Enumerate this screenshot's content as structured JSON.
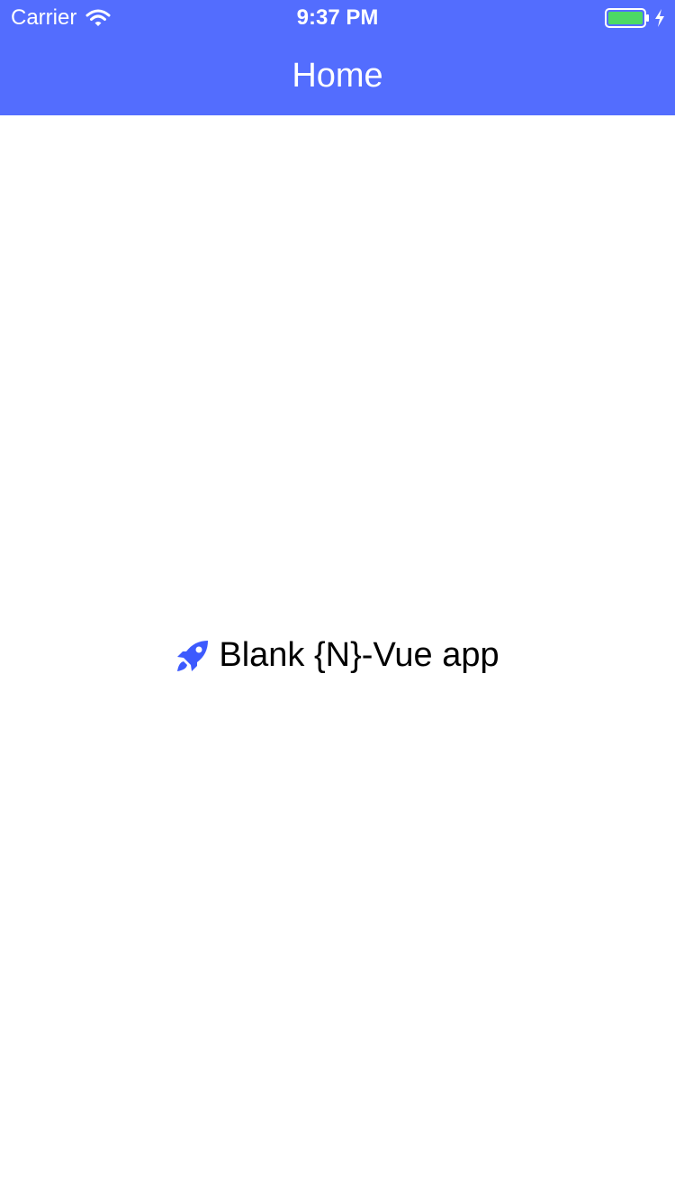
{
  "status_bar": {
    "carrier": "Carrier",
    "time": "9:37 PM",
    "icons": [
      "wifi-icon",
      "battery-icon",
      "charging-icon"
    ],
    "battery_color": "#4CD964"
  },
  "nav": {
    "title": "Home",
    "background_color": "#536DFE"
  },
  "content": {
    "icon": "rocket-icon",
    "icon_color": "#3D5AFE",
    "message": "Blank {N}-Vue app"
  }
}
